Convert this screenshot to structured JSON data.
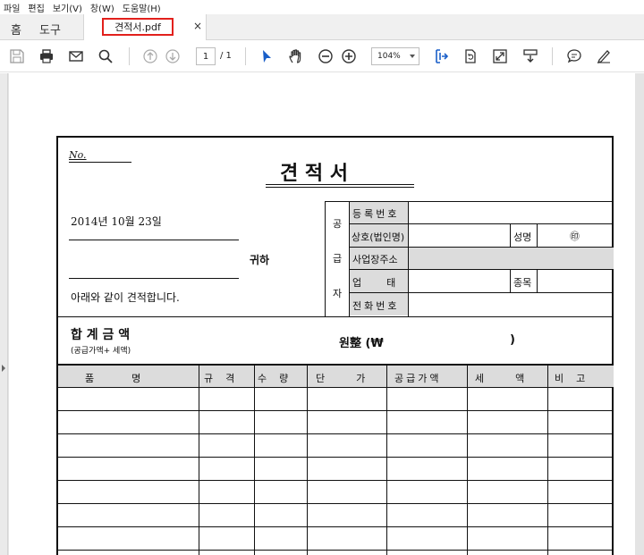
{
  "menu": [
    "파일",
    "편집",
    "보기(V)",
    "창(W)",
    "도움말(H)"
  ],
  "tabs": {
    "home": "홈",
    "tools": "도구",
    "document": "견적서.pdf",
    "close": "×"
  },
  "toolbar": {
    "page_current": "1",
    "page_total": "/ 1",
    "zoom": "104%"
  },
  "icons": [
    "save-icon",
    "print-icon",
    "email-icon",
    "search-icon",
    "page-up-icon",
    "page-down-icon",
    "select-cursor-icon",
    "hand-icon",
    "zoom-out-icon",
    "zoom-in-icon",
    "fit-page-icon",
    "rotate-icon",
    "fullscreen-icon",
    "scroll-mode-icon",
    "comment-icon",
    "sign-icon"
  ],
  "document": {
    "no": "No.",
    "title": "견   적   서",
    "date": "2014년 10월 23일",
    "recipient_suffix": "귀하",
    "intro": "아래와 같이 견적합니다.",
    "supplier_label": [
      "공",
      "급",
      "자"
    ],
    "supplier_rows": [
      "등록번호",
      "상호(법인명)",
      "사업장주소",
      "업        태",
      "전화번호"
    ],
    "name_label": "성명",
    "seal": "㊞",
    "business_type_label": "종목",
    "total_label": "합 계 금 액",
    "total_sub": "(공급가액+ 세액)",
    "total_amount": "원整 (₩",
    "total_close": ")",
    "columns": [
      "품            명",
      "규    격",
      "수    량",
      "단          가",
      "공급가액",
      "세          액",
      "비    고"
    ]
  }
}
